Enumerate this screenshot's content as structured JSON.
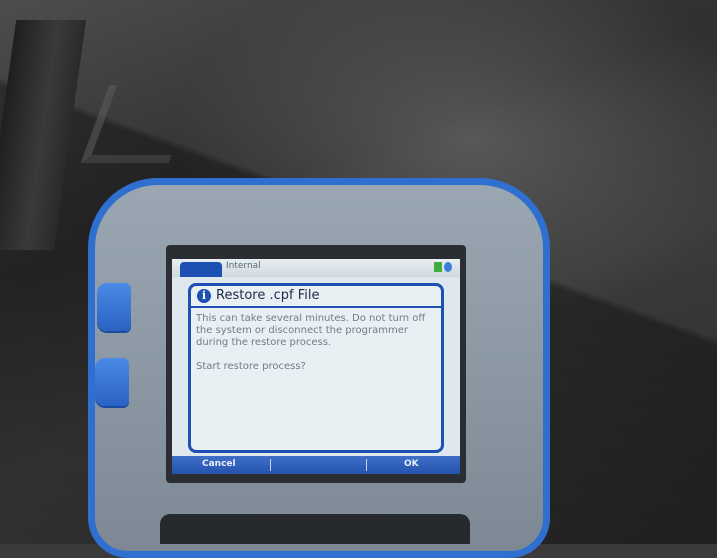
{
  "screen": {
    "top_bar": {
      "title": "Internal"
    },
    "dialog": {
      "title": "Restore .cpf File",
      "message": "This can take several minutes. Do not turn off the system or disconnect the programmer during the restore process.",
      "prompt": "Start restore process?"
    },
    "softkeys": {
      "left_label": "Cancel",
      "right_label": "OK"
    }
  },
  "colors": {
    "device_accent": "#2f6fd0",
    "dialog_border": "#1e4fb2",
    "softkey_bar": "#2453ad"
  },
  "icons": {
    "dialog_icon": "info-icon",
    "status_icons": [
      "battery-icon",
      "signal-icon"
    ]
  }
}
